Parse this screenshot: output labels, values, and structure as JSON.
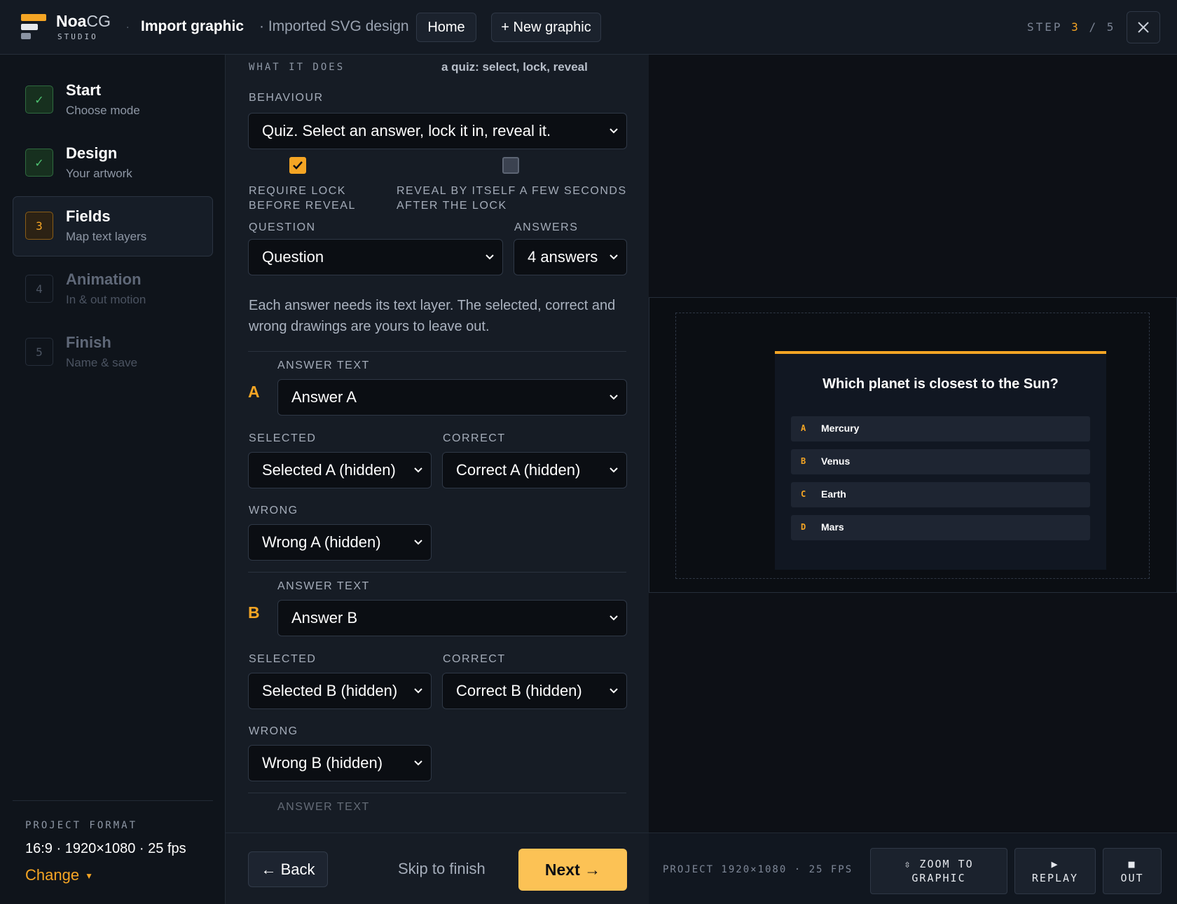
{
  "app": {
    "brand_bold": "Noa",
    "brand_light": "CG",
    "brand_sub": "STUDIO"
  },
  "header": {
    "title": "Import graphic",
    "subtitle": "· Imported SVG design",
    "home_label": "Home",
    "new_label": "+ New graphic",
    "step_prefix": "STEP",
    "step_current": "3",
    "step_sep": "/",
    "step_total": "5"
  },
  "sidebar": {
    "steps": [
      {
        "num": "✓",
        "title": "Start",
        "desc": "Choose mode"
      },
      {
        "num": "✓",
        "title": "Design",
        "desc": "Your artwork"
      },
      {
        "num": "3",
        "title": "Fields",
        "desc": "Map text layers"
      },
      {
        "num": "4",
        "title": "Animation",
        "desc": "In & out motion"
      },
      {
        "num": "5",
        "title": "Finish",
        "desc": "Name & save"
      }
    ],
    "format_label": "PROJECT FORMAT",
    "format_value": "16:9 · 1920×1080 · 25 fps",
    "change_label": "Change"
  },
  "form": {
    "what_label": "WHAT IT DOES",
    "what_value": "a quiz: select, lock, reveal",
    "behaviour_label": "BEHAVIOUR",
    "behaviour_value": "Quiz. Select an answer, lock it in, reveal it.",
    "require_lock_label": "REQUIRE LOCK BEFORE REVEAL",
    "require_lock_checked": true,
    "reveal_auto_label": "REVEAL BY ITSELF A FEW SECONDS AFTER THE LOCK",
    "reveal_auto_checked": false,
    "question_label": "QUESTION",
    "question_value": "Question",
    "answers_label": "ANSWERS",
    "answers_value": "4 answers",
    "help_text": "Each answer needs its text layer. The selected, correct and wrong drawings are yours to leave out.",
    "answer_text_label": "ANSWER TEXT",
    "selected_label": "SELECTED",
    "correct_label": "CORRECT",
    "wrong_label": "WRONG",
    "answers": [
      {
        "letter": "A",
        "text": "Answer A",
        "selected": "Selected A (hidden)",
        "correct": "Correct A (hidden)",
        "wrong": "Wrong A (hidden)"
      },
      {
        "letter": "B",
        "text": "Answer B",
        "selected": "Selected B (hidden)",
        "correct": "Correct B (hidden)",
        "wrong": "Wrong B (hidden)"
      }
    ]
  },
  "footer": {
    "back_label": "← Back",
    "skip_label": "Skip to finish",
    "next_label": "Next →"
  },
  "preview": {
    "question": "Which planet is closest to the Sun?",
    "answers": [
      {
        "letter": "A",
        "text": "Mercury"
      },
      {
        "letter": "B",
        "text": "Venus"
      },
      {
        "letter": "C",
        "text": "Earth"
      },
      {
        "letter": "D",
        "text": "Mars"
      }
    ],
    "project_info": "PROJECT 1920×1080 · 25 FPS",
    "zoom_label_1": "⇳ ZOOM TO",
    "zoom_label_2": "GRAPHIC",
    "replay_icon": "▶",
    "replay_label": "REPLAY",
    "out_icon": "■",
    "out_label": "OUT"
  },
  "colors": {
    "accent": "#f5a524",
    "next_button": "#fcc255",
    "done": "#4ec271"
  }
}
